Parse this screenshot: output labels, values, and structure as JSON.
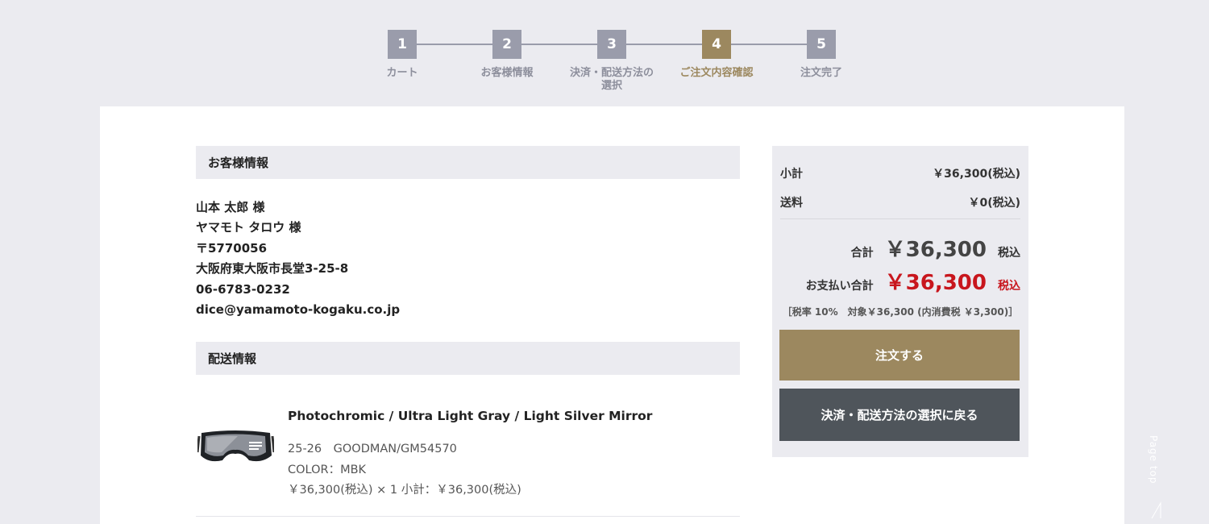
{
  "stepper": {
    "steps": [
      {
        "num": "1",
        "label": "カート"
      },
      {
        "num": "2",
        "label": "お客様情報"
      },
      {
        "num": "3",
        "label": "決済・配送方法の\n選択"
      },
      {
        "num": "4",
        "label": "ご注文内容確認"
      },
      {
        "num": "5",
        "label": "注文完了"
      }
    ],
    "active_step": "4",
    "colors": {
      "inactive": "#9a9cab",
      "active": "#9c885f"
    }
  },
  "customer": {
    "header": "お客様情報",
    "name": "山本 太郎 様",
    "kana": "ヤマモト タロウ 様",
    "postal": "〒5770056",
    "address": "大阪府東大阪市長堂3-25-8",
    "phone": "06-6783-0232",
    "email": "dice@yamamoto-kogaku.co.jp"
  },
  "shipping": {
    "header": "配送情報",
    "item": {
      "name": "Photochromic / Ultra Light Gray / Light Silver Mirror",
      "model": "25-26　GOODMAN/GM54570",
      "color": "COLOR：MBK",
      "price_line": "￥36,300(税込) × 1 小計：￥36,300(税込)",
      "image": "ski-goggle-image"
    }
  },
  "summary": {
    "subtotal_label": "小計",
    "subtotal_value": "￥36,300(税込)",
    "shipping_label": "送料",
    "shipping_value": "￥0(税込)",
    "total_label": "合計",
    "total_value": "￥36,300",
    "total_tax": "税込",
    "payment_label": "お支払い合計",
    "payment_value": "￥36,300",
    "payment_tax": "税込",
    "tax_note": "［税率 10%　対象￥36,300 (内消費税 ￥3,300)］",
    "order_button": "注文する",
    "back_button": "決済・配送方法の選択に戻る",
    "colors": {
      "order_button": "#9c885f",
      "back_button": "#4f555b",
      "payment_total": "#c8161d"
    }
  },
  "page_top": {
    "label": "Page top",
    "icon": "arrow-up-icon"
  }
}
